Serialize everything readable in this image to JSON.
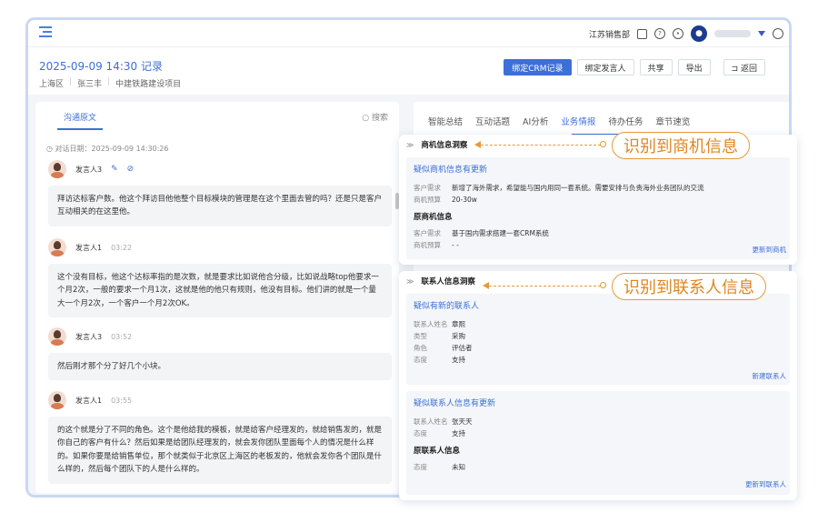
{
  "topbar": {
    "org": "江苏销售部"
  },
  "record": {
    "title": "2025-09-09 14:30 记录",
    "meta": [
      "上海区",
      "张三丰",
      "中建铁路建设项目"
    ]
  },
  "actions": {
    "bind_crm": "绑定CRM记录",
    "bind_speaker": "绑定发言人",
    "share": "共享",
    "export": "导出",
    "back": "⊐ 返回"
  },
  "left": {
    "tab": "沟通原文",
    "search": "搜索",
    "date": "对话日期：2025-09-09 14:30:26",
    "messages": [
      {
        "speaker": "发言人3",
        "time": "",
        "text": "拜访达标客户数。他这个拜访目他他整个目标模块的管理是在这个里面去管的吗？还是只是客户互动相关的在这里他。"
      },
      {
        "speaker": "发言人1",
        "time": "03:22",
        "text": "这个没有目标，他这个达标率指的是次数，就是要求比如说他合分级，比如说战略top他要求一个月2次，一般的要求一个月1次，这就是他的他只有规则，他没有目标。他们讲的就是一个量大一个月2次，一个客户一个月2次OK。"
      },
      {
        "speaker": "发言人3",
        "time": "03:52",
        "text": "然后刚才那个分了好几个小块。"
      },
      {
        "speaker": "发言人1",
        "time": "03:55",
        "text": "的这个就是分了不同的角色。这个是他给我的模板，就是给客户经理发的，就给销售发的，就是你自己的客户有什么？然后如果是给团队经理发的，就会发你团队里面每个人的情况是什么样的。如果你要是给销售单位，那个就类似于北京区上海区的老板发的，他就会发你各个团队是什么样的，然后每个团队下的人是什么样的。"
      }
    ]
  },
  "right": {
    "tabs": [
      "智能总结",
      "互动话题",
      "AI分析",
      "业务情报",
      "待办任务",
      "章节速览"
    ],
    "active_tab": "业务情报"
  },
  "opportunity": {
    "header": "商机信息洞察",
    "suggest_title": "疑似商机信息有更新",
    "suggest_fields": [
      {
        "k": "客户需求",
        "v": "新增了海外需求，希望能与国内用同一套系统。需要安排与负责海外业务团队的交流"
      },
      {
        "k": "商机预算",
        "v": "20-30w"
      }
    ],
    "original_title": "原商机信息",
    "original_fields": [
      {
        "k": "客户需求",
        "v": "基于国内需求搭建一套CRM系统"
      },
      {
        "k": "商机预算",
        "v": "- -"
      }
    ],
    "link": "更新到商机",
    "callout": "识别到商机信息"
  },
  "contact": {
    "header": "联系人信息洞察",
    "new_title": "疑似有新的联系人",
    "new_fields": [
      {
        "k": "联系人姓名",
        "v": "章熙"
      },
      {
        "k": "类型",
        "v": "采购"
      },
      {
        "k": "角色",
        "v": "评估者"
      },
      {
        "k": "态度",
        "v": "支持"
      }
    ],
    "new_link": "新建联系人",
    "update_title": "疑似联系人信息有更新",
    "update_fields": [
      {
        "k": "联系人姓名",
        "v": "张天天"
      },
      {
        "k": "态度",
        "v": "支持"
      }
    ],
    "original_title": "原联系人信息",
    "original_fields": [
      {
        "k": "态度",
        "v": "未知"
      }
    ],
    "update_link": "更新到联系人",
    "callout": "识别到联系人信息"
  }
}
